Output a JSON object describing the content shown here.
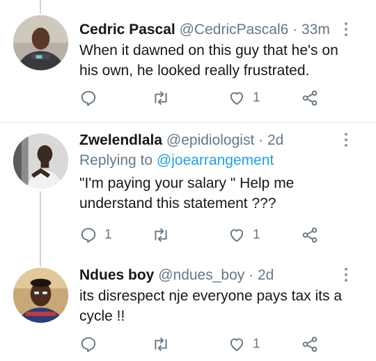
{
  "tweets": [
    {
      "name": "Cedric Pascal",
      "handle": "@CedricPascal6",
      "time": "33m",
      "replying_to": null,
      "text_lines": [
        "When it dawned on this guy that he's on",
        "his own, he looked really frustrated."
      ],
      "reply_count": "",
      "retweet_count": "",
      "like_count": "1"
    },
    {
      "name": "Zwelendlala",
      "handle": "@epidiologist",
      "time": "2d",
      "replying_to": {
        "label": "Replying to",
        "handle": "@joearrangement"
      },
      "text_lines": [
        "\"I'm paying your salary \" Help me",
        "understand this statement ???"
      ],
      "reply_count": "1",
      "retweet_count": "",
      "like_count": "1"
    },
    {
      "name": "Ndues boy",
      "handle": "@ndues_boy",
      "time": "2d",
      "replying_to": null,
      "text_lines": [
        "its disrespect nje everyone pays tax its a",
        "cycle !!"
      ],
      "reply_count": "",
      "retweet_count": "",
      "like_count": "1"
    }
  ],
  "separator": " · ",
  "icons": {
    "reply": "reply-icon",
    "retweet": "retweet-icon",
    "like": "heart-icon",
    "share": "share-icon",
    "more": "more-vertical-icon"
  },
  "colors": {
    "text": "#14171a",
    "secondary": "#657786",
    "link": "#1da1f2",
    "divider": "#e1e8ed",
    "thread_line": "#ccd6dd"
  }
}
